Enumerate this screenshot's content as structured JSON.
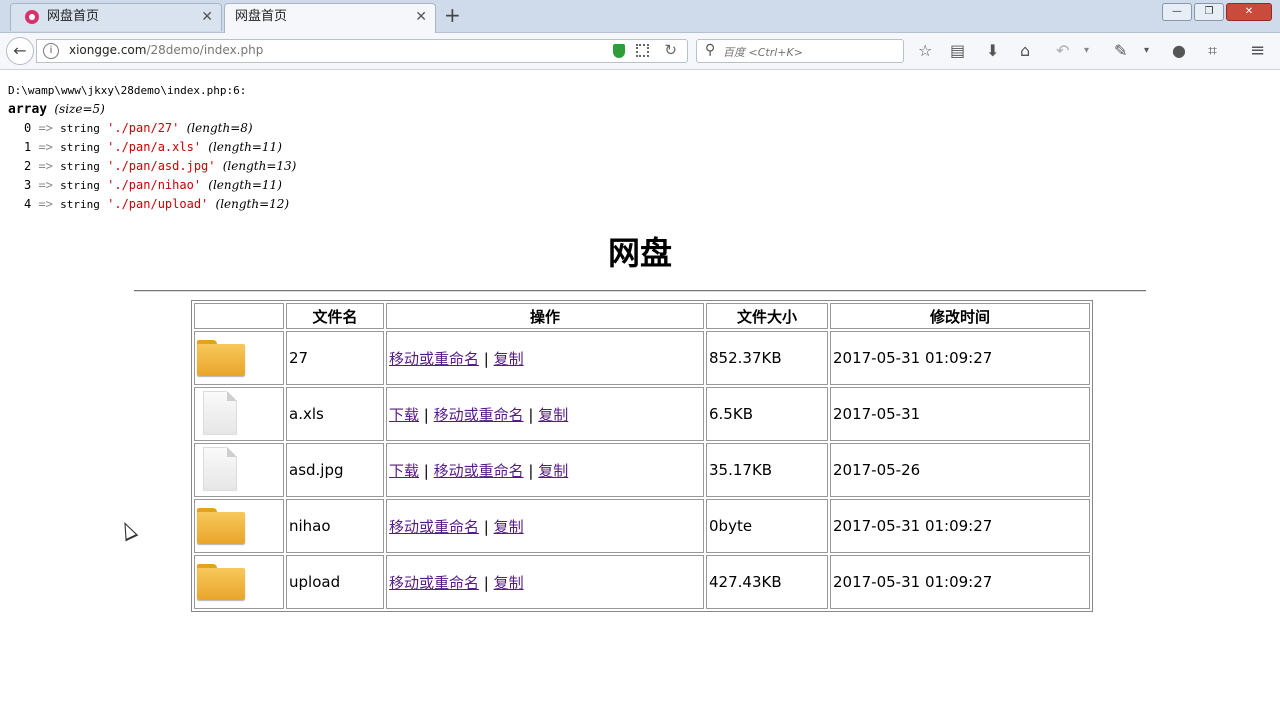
{
  "browser": {
    "tabs": [
      {
        "label": "网盘首页",
        "active": false
      },
      {
        "label": "网盘首页",
        "active": true
      }
    ],
    "new_tab": "+",
    "window_buttons": [
      "—",
      "❐",
      "✕"
    ],
    "url_host": "xiongge.com",
    "url_path": "/28demo/index.php",
    "search_placeholder": "百度 <Ctrl+K>",
    "toolbar_icons": [
      "star-icon",
      "reading-list-icon",
      "download-icon",
      "home-icon",
      "undo-icon",
      "extension-icon",
      "chat-icon",
      "crop-icon",
      "menu-icon"
    ]
  },
  "dump": {
    "file_line": "D:\\wamp\\www\\jkxy\\28demo\\index.php:6:",
    "array_word": "array",
    "array_size": "(size=5)",
    "items": [
      {
        "index": "0",
        "type": "string",
        "value": "'./pan/27'",
        "length": "(length=8)"
      },
      {
        "index": "1",
        "type": "string",
        "value": "'./pan/a.xls'",
        "length": "(length=11)"
      },
      {
        "index": "2",
        "type": "string",
        "value": "'./pan/asd.jpg'",
        "length": "(length=13)"
      },
      {
        "index": "3",
        "type": "string",
        "value": "'./pan/nihao'",
        "length": "(length=11)"
      },
      {
        "index": "4",
        "type": "string",
        "value": "'./pan/upload'",
        "length": "(length=12)"
      }
    ]
  },
  "page": {
    "title": "网盘",
    "columns": [
      "",
      "文件名",
      "操作",
      "文件大小",
      "修改时间"
    ],
    "rows": [
      {
        "icon": "folder",
        "name": "27",
        "ops": [
          "移动或重命名",
          "复制"
        ],
        "size": "852.37KB",
        "time": "2017-05-31 01:09:27"
      },
      {
        "icon": "file",
        "name": "a.xls",
        "ops": [
          "下载",
          "移动或重命名",
          "复制"
        ],
        "size": "6.5KB",
        "time": "2017-05-31"
      },
      {
        "icon": "file",
        "name": "asd.jpg",
        "ops": [
          "下载",
          "移动或重命名",
          "复制"
        ],
        "size": "35.17KB",
        "time": "2017-05-26"
      },
      {
        "icon": "folder",
        "name": "nihao",
        "ops": [
          "移动或重命名",
          "复制"
        ],
        "size": "0byte",
        "time": "2017-05-31 01:09:27"
      },
      {
        "icon": "folder",
        "name": "upload",
        "ops": [
          "移动或重命名",
          "复制"
        ],
        "size": "427.43KB",
        "time": "2017-05-31 01:09:27"
      }
    ],
    "separator": " | "
  }
}
